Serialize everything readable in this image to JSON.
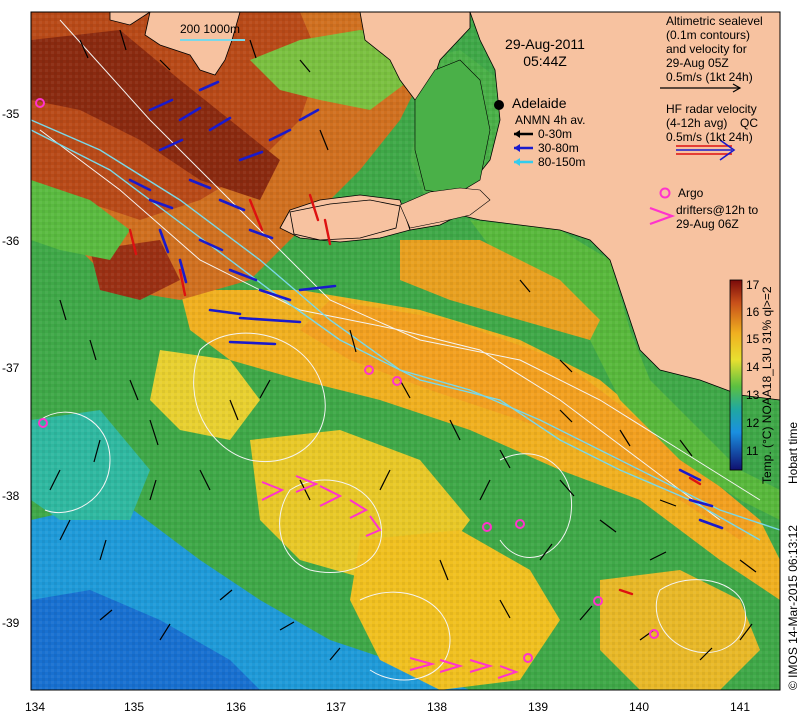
{
  "map": {
    "date": "29-Aug-2011",
    "time": "05:44Z",
    "scale_label": "200  1000m",
    "city": "Adelaide",
    "x_ticks": [
      "134",
      "135",
      "136",
      "137",
      "138",
      "139",
      "140",
      "141"
    ],
    "y_ticks": [
      "-35",
      "-36",
      "-37",
      "-38",
      "-39"
    ],
    "altimetric_legend": [
      "Altimetric sealevel",
      "(0.1m contours)",
      "and velocity for",
      "29-Aug 05Z",
      "0.5m/s (1kt 24h)"
    ],
    "hf_legend": [
      "HF radar velocity",
      "(4-12h avg)",
      "0.5m/s (1kt 24h)"
    ],
    "hf_qc_label": "QC",
    "anmn_legend": {
      "title": "ANMN 4h av.",
      "rows": [
        {
          "label": "0-30m",
          "color": "#000000"
        },
        {
          "label": "30-80m",
          "color": "#1a1acc"
        },
        {
          "label": "80-150m",
          "color": "#33ccee"
        }
      ]
    },
    "argo_legend": [
      "Argo",
      "drifters@12h to",
      "29-Aug 06Z"
    ],
    "colorbar": {
      "ticks": [
        "17",
        "16",
        "15",
        "14",
        "13",
        "12",
        "11"
      ],
      "label": "Temp. (°C) NOAA18_L3U 31% ql>=2",
      "hobart": "Hobart time"
    },
    "credit": "© IMOS 14-Mar-2015 06:13:12"
  }
}
